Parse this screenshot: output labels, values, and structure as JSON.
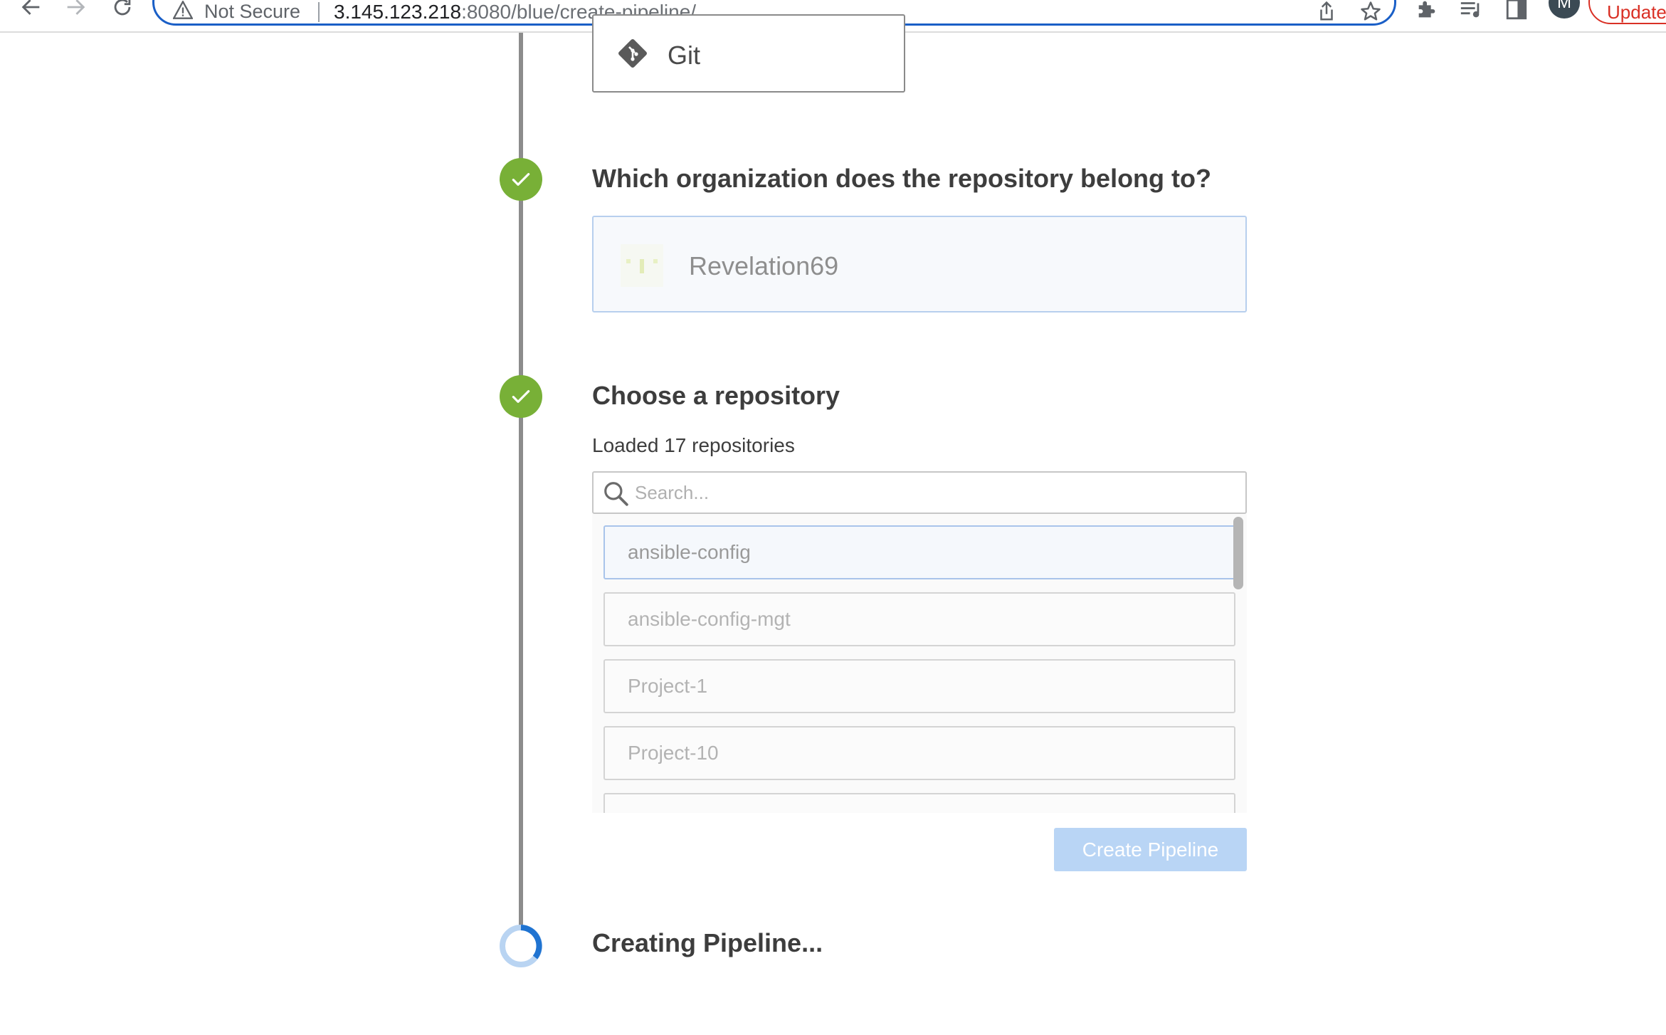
{
  "browser": {
    "security_label": "Not Secure",
    "url_host": "3.145.123.218",
    "url_path": ":8080/blue/create-pipeline/",
    "profile_initial": "M",
    "update_label": "Update"
  },
  "source_card": {
    "label": "Git",
    "icon": "git-icon"
  },
  "steps": {
    "organization": {
      "heading": "Which organization does the repository belong to?",
      "status": "done",
      "selected_org": "Revelation69"
    },
    "repository": {
      "heading": "Choose a repository",
      "status": "done",
      "loaded_text": "Loaded 17 repositories",
      "search_placeholder": "Search...",
      "search_value": "",
      "items": [
        {
          "name": "ansible-config",
          "selected": true
        },
        {
          "name": "ansible-config-mgt",
          "selected": false
        },
        {
          "name": "Project-1",
          "selected": false
        },
        {
          "name": "Project-10",
          "selected": false
        },
        {
          "name": "",
          "selected": false
        }
      ],
      "create_button": "Create Pipeline"
    },
    "creating": {
      "heading": "Creating Pipeline...",
      "status": "in-progress"
    }
  },
  "colors": {
    "step_done": "#78b037",
    "progress_ring": "#1f73d1",
    "selected_border": "#a9c4ea",
    "primary_button_disabled": "#b9d5f5",
    "omnibox_border": "#1a5fc7",
    "update_accent": "#d93025"
  }
}
